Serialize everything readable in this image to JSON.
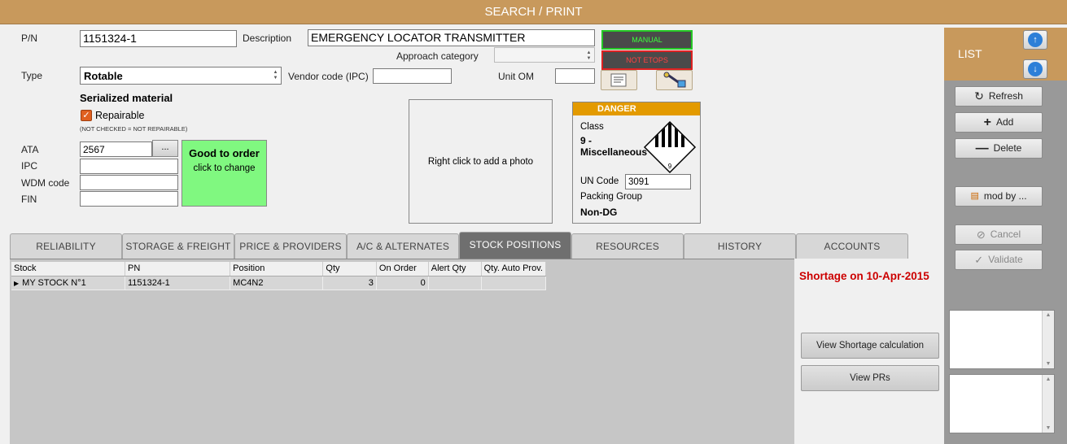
{
  "window": {
    "title": "SEARCH / PRINT"
  },
  "form": {
    "pn_label": "P/N",
    "pn_value": "1151324-1",
    "description_label": "Description",
    "description_value": "EMERGENCY LOCATOR TRANSMITTER",
    "approach_label": "Approach category",
    "approach_value": "",
    "manual_badge": "MANUAL",
    "etops_badge": "NOT ETOPS",
    "type_label": "Type",
    "type_value": "Rotable",
    "vendor_label": "Vendor code (IPC)",
    "vendor_value": "",
    "unit_om_label": "Unit OM",
    "unit_om_value": "",
    "serialized_label": "Serialized material",
    "repairable_label": "Repairable",
    "repairable_note": "(NOT CHECKED = NOT REPAIRABLE)",
    "ata_label": "ATA",
    "ata_value": "2567",
    "ata_browse": "...",
    "ipc_label": "IPC",
    "ipc_value": "",
    "wdm_label": "WDM code",
    "wdm_value": "",
    "fin_label": "FIN",
    "fin_value": "",
    "status_title": "Good to order",
    "status_hint": "click to change",
    "status_color": "#80f880",
    "photo_hint": "Right click to add a photo"
  },
  "danger": {
    "header": "DANGER",
    "header_color": "#e39a00",
    "class_label": "Class",
    "class_value_1": "9 -",
    "class_value_2": "Miscellaneous",
    "diamond_number": "9",
    "un_label": "UN Code",
    "un_value": "3091",
    "packing_label": "Packing Group",
    "packing_value": "Non-DG"
  },
  "tabs": [
    {
      "label": "RELIABILITY"
    },
    {
      "label": "STORAGE & FREIGHT"
    },
    {
      "label": "PRICE & PROVIDERS"
    },
    {
      "label": "A/C & ALTERNATES"
    },
    {
      "label": "STOCK POSITIONS"
    },
    {
      "label": "RESOURCES"
    },
    {
      "label": "HISTORY"
    },
    {
      "label": "ACCOUNTS"
    }
  ],
  "grid": {
    "columns": [
      "Stock",
      "PN",
      "Position",
      "Qty",
      "On Order",
      "Alert Qty",
      "Qty. Auto Prov."
    ],
    "rows": [
      {
        "stock": "MY STOCK N°1",
        "pn": "1151324-1",
        "position": "MC4N2",
        "qty": "3",
        "on_order": "0",
        "alert_qty": "",
        "auto_prov": ""
      }
    ]
  },
  "shortage": {
    "text": "Shortage on 10-Apr-2015",
    "color": "#cc0000",
    "view_calc": "View Shortage calculation",
    "view_prs": "View PRs"
  },
  "sidebar": {
    "list_label": "LIST",
    "refresh": "Refresh",
    "add": "Add",
    "delete": "Delete",
    "mod_by": "mod by ...",
    "cancel": "Cancel",
    "validate": "Validate"
  }
}
